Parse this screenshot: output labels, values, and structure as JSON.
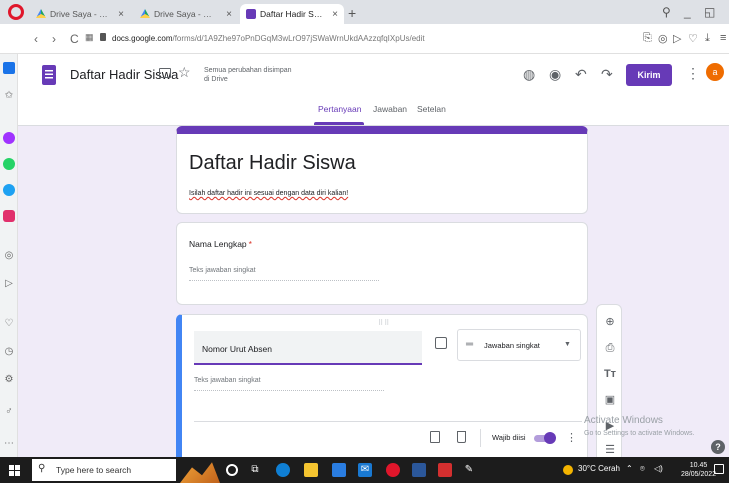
{
  "browser": {
    "tabs": [
      {
        "title": "Drive Saya - Google Drive",
        "icon": "drive-icon"
      },
      {
        "title": "Drive Saya - Google Drive",
        "icon": "drive-icon"
      },
      {
        "title": "Daftar Hadir Siswa - Goog",
        "icon": "forms-icon"
      }
    ],
    "url_domain": "docs.google.com",
    "url_path": "/forms/d/1A9Zhe97oPnDGqM3wLrO97jSWaWrnUkdAAzzqfqIXpUs/edit"
  },
  "forms": {
    "doc_title": "Daftar Hadir Siswa",
    "save_status_line1": "Semua perubahan disimpan",
    "save_status_line2": "di Drive",
    "send_label": "Kirim",
    "avatar_initial": "a",
    "tabs": [
      "Pertanyaan",
      "Jawaban",
      "Setelan"
    ],
    "active_tab": "Pertanyaan",
    "accent_color": "#673ab7"
  },
  "form": {
    "title": "Daftar Hadir Siswa",
    "description": "Isilah daftar hadir ini sesuai dengan data diri kalian!",
    "questions": [
      {
        "label": "Nama Lengkap",
        "required": "*",
        "answer_placeholder": "Teks jawaban singkat"
      },
      {
        "label": "Nomor Urut Absen",
        "answer_placeholder": "Teks jawaban singkat",
        "type": "Jawaban singkat",
        "required_label": "Wajib diisi",
        "required_on": true
      }
    ]
  },
  "watermark": {
    "line1": "Activate Windows",
    "line2": "Go to Settings to activate Windows."
  },
  "taskbar": {
    "search_placeholder": "Type here to search",
    "weather": "30°C  Cerah",
    "time": "10.45",
    "date": "28/05/2022"
  }
}
